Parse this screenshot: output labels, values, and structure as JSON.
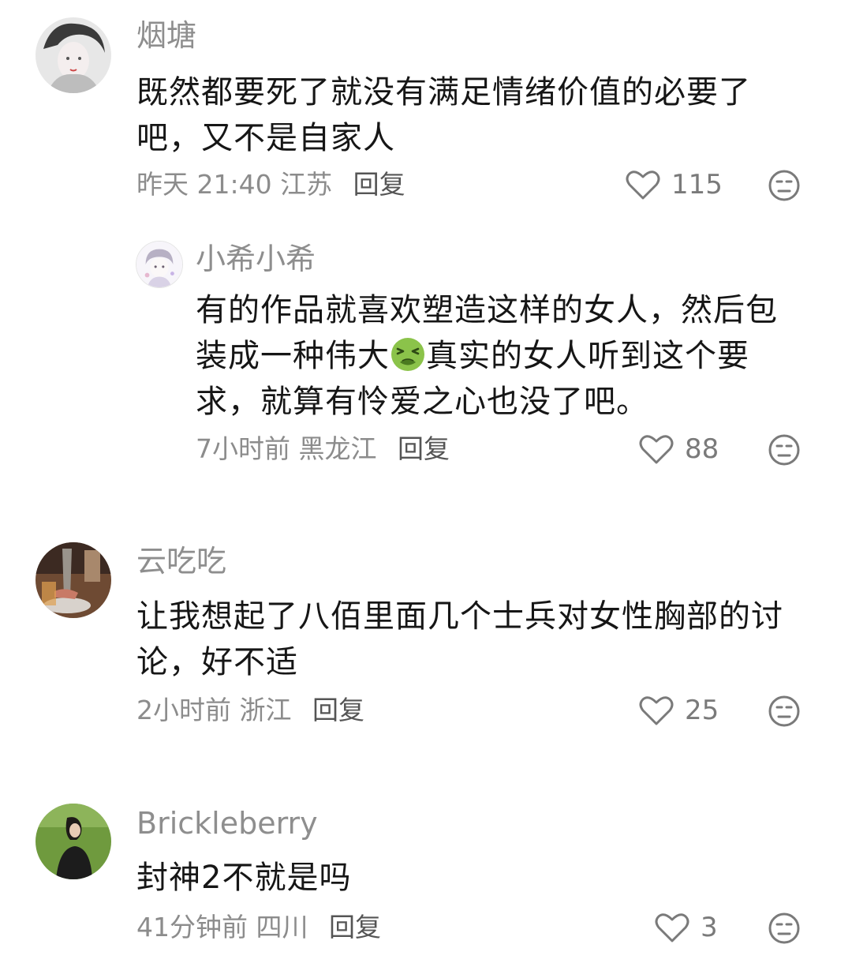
{
  "comments": [
    {
      "username": "烟塘",
      "text": "既然都要死了就没有满足情绪价值的必要了吧，又不是自家人",
      "time": "昨天 21:40",
      "location": "江苏",
      "reply_label": "回复",
      "likes": "115"
    },
    {
      "username": "小希小希",
      "text_before": "有的作品就喜欢塑造这样的女人，然后包装成一种伟大",
      "text_after": "真实的女人听到这个要求，就算有怜爱之心也没了吧。",
      "time": "7小时前",
      "location": "黑龙江",
      "reply_label": "回复",
      "likes": "88"
    },
    {
      "username": "云吃吃",
      "text": "让我想起了八佰里面几个士兵对女性胸部的讨论，好不适",
      "time": "2小时前",
      "location": "浙江",
      "reply_label": "回复",
      "likes": "25"
    },
    {
      "username": "Brickleberry",
      "text": "封神2不就是吗",
      "time": "41分钟前",
      "location": "四川",
      "reply_label": "回复",
      "likes": "3"
    }
  ],
  "icons": {
    "like": "heart-outline-icon",
    "dislike": "unamused-face-icon",
    "inline_emoji": "nauseated-face-emoji"
  },
  "colors": {
    "username": "#8e8e8e",
    "text": "#161616",
    "meta": "#8c8c8c"
  }
}
